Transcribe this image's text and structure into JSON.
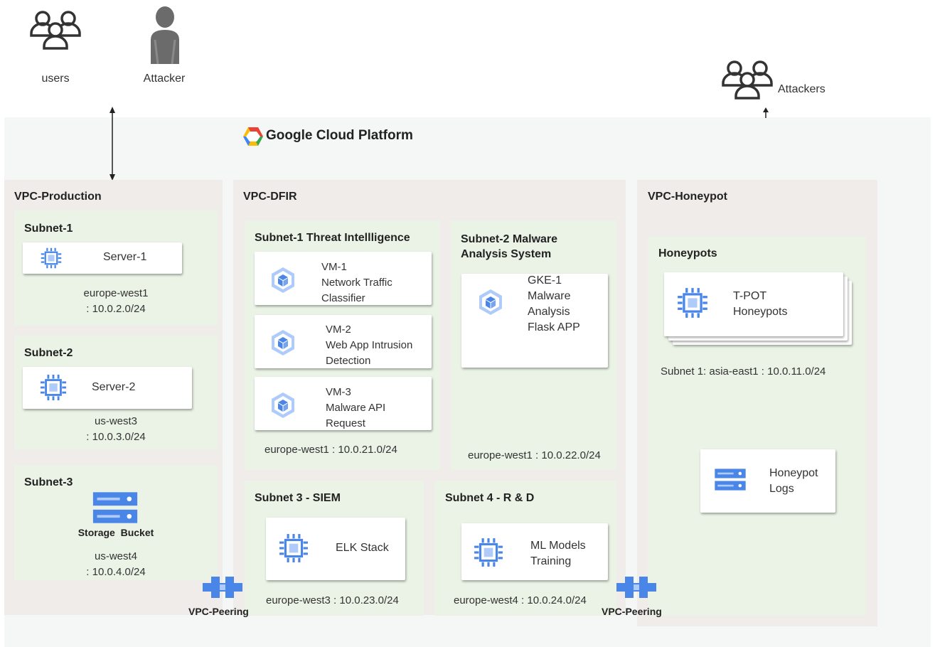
{
  "top": {
    "users_label": "users",
    "attacker_label": "Attacker",
    "attackers_label": "Attackers"
  },
  "gcp": {
    "title": "Google Cloud Platform"
  },
  "vpc_production": {
    "title": "VPC-Production",
    "subnet1": {
      "title": "Subnet-1",
      "server": "Server-1",
      "region": "europe-west1\n: 10.0.2.0/24"
    },
    "subnet2": {
      "title": "Subnet-2",
      "server": "Server-2",
      "region": "us-west3\n: 10.0.3.0/24"
    },
    "subnet3": {
      "title": "Subnet-3",
      "storage": "Storage  Bucket",
      "region": "us-west4\n: 10.0.4.0/24"
    }
  },
  "vpc_dfir": {
    "title": "VPC-DFIR",
    "subnet1": {
      "title": "Subnet-1 Threat Intellligence",
      "vm1": "VM-1\nNetwork Traffic\nClassifier",
      "vm2": "VM-2\nWeb App Intrusion\nDetection",
      "vm3": "VM-3\nMalware API\nRequest",
      "region": "europe-west1 : 10.0.21.0/24"
    },
    "subnet2": {
      "title": "Subnet-2 Malware\nAnalysis System",
      "gke": "GKE-1\nMalware\nAnalysis\nFlask APP",
      "region": "europe-west1 : 10.0.22.0/24"
    },
    "subnet3": {
      "title": "Subnet 3 - SIEM",
      "elk": "ELK Stack",
      "region": "europe-west3 : 10.0.23.0/24"
    },
    "subnet4": {
      "title": "Subnet 4 - R & D",
      "ml": "ML Models\nTraining",
      "region": "europe-west4 : 10.0.24.0/24"
    }
  },
  "vpc_honeypot": {
    "title": "VPC-Honeypot",
    "honeypots": {
      "title": "Honeypots",
      "tpot": "T-POT\nHoneypots",
      "region": "Subnet 1: asia-east1 : 10.0.11.0/24",
      "logs": "Honeypot\nLogs"
    }
  },
  "peering": {
    "left_label": "VPC-Peering",
    "right_label": "VPC-Peering"
  },
  "colors": {
    "gcp_bg": "#f5f6f6",
    "vpc_bg": "#efecea",
    "subnet_bg": "#eaf3e6",
    "icon_blue": "#4a86e8",
    "icon_light": "#aecbfa",
    "people_stroke": "#333333"
  }
}
